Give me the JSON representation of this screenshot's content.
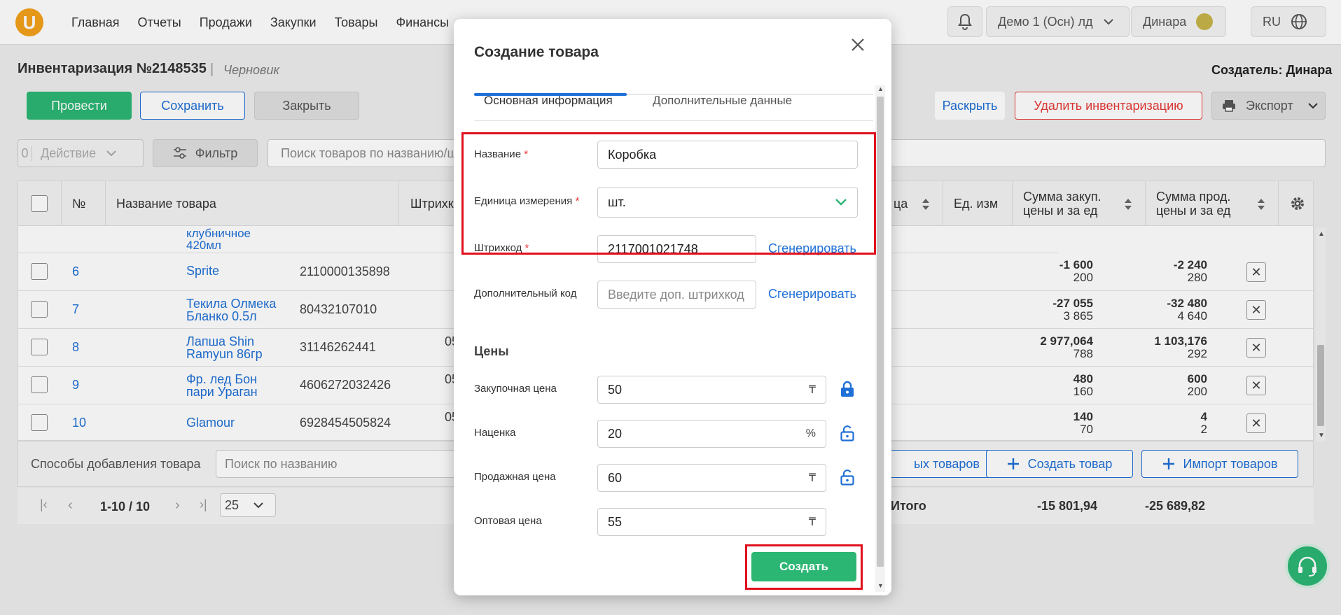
{
  "nav": {
    "logo": "U",
    "items": [
      "Главная",
      "Отчеты",
      "Продажи",
      "Закупки",
      "Товары",
      "Финансы"
    ],
    "store": "Демо 1 (Осн) лд",
    "user": "Динара",
    "lang": "RU"
  },
  "page": {
    "title": "Инвентаризация №2148535",
    "separator": "|",
    "status": "Черновик",
    "creator": "Создатель: Динара"
  },
  "toolbar": {
    "conduct": "Провести",
    "save": "Сохранить",
    "close": "Закрыть",
    "expand": "Раскрыть",
    "delete": "Удалить инвентаризацию",
    "export": "Экспорт",
    "action_count": "0",
    "action": "Действие",
    "filter": "Фильтр",
    "search_placeholder": "Поиск товаров по названию/ш"
  },
  "table": {
    "headers": {
      "num": "№",
      "name": "Название товара",
      "barcode": "Штрихк",
      "price": "ца",
      "unit": "Ед. изм",
      "sum_buy_1": "Сумма закуп.",
      "sum_buy_2": "цены и за ед",
      "sum_sell_1": "Сумма прод.",
      "sum_sell_2": "цены и за ед"
    },
    "partial_row": {
      "name_1": "клубничное",
      "name_2": "420мл"
    },
    "rows": [
      {
        "num": "6",
        "name_1": "Sprite",
        "name_2": "",
        "barcode": "2110000135898",
        "extra": "",
        "buy_total": "-1 600",
        "buy_unit": "200",
        "sell_total": "-2 240",
        "sell_unit": "280"
      },
      {
        "num": "7",
        "name_1": "Текила Олмека",
        "name_2": "Бланко 0.5л",
        "barcode": "80432107010",
        "extra": "",
        "buy_total": "-27 055",
        "buy_unit": "3 865",
        "sell_total": "-32 480",
        "sell_unit": "4 640"
      },
      {
        "num": "8",
        "name_1": "Лапша Shin",
        "name_2": "Ramyun 86гр",
        "barcode": "31146262441",
        "extra": "05",
        "buy_total": "2 977,064",
        "buy_unit": "788",
        "sell_total": "1 103,176",
        "sell_unit": "292"
      },
      {
        "num": "9",
        "name_1": "Фр. лед Бон",
        "name_2": "пари Ураган",
        "barcode": "4606272032426",
        "extra": "05",
        "buy_total": "480",
        "buy_unit": "160",
        "sell_total": "600",
        "sell_unit": "200"
      },
      {
        "num": "10",
        "name_1": "Glamour",
        "name_2": "",
        "barcode": "6928454505824",
        "extra": "05",
        "buy_total": "140",
        "buy_unit": "70",
        "sell_total": "4",
        "sell_unit": "2"
      }
    ],
    "add_methods": "Способы добавления товара",
    "add_search_placeholder": "Поиск по названию",
    "partial_btn": "ых товаров",
    "create_product": "Создать товар",
    "import_products": "Импорт товаров",
    "pagination": "1-10 / 10",
    "page_size": "25",
    "total_label": "Итого",
    "total_buy": "-15 801,94",
    "total_sell": "-25 689,82"
  },
  "modal": {
    "title": "Создание товара",
    "tabs": [
      "Основная информация",
      "Дополнительные данные"
    ],
    "name_label": "Название",
    "name_value": "Коробка",
    "unit_label": "Единица измерения",
    "unit_value": "шт.",
    "barcode_label": "Штрихкод",
    "barcode_value": "2117001021748",
    "generate": "Сгенерировать",
    "extra_code_label": "Дополнительный код",
    "extra_code_placeholder": "Введите доп. штрихкод",
    "required_mark": "*",
    "prices_heading": "Цены",
    "buy_label": "Закупочная цена",
    "buy_value": "50",
    "markup_label": "Наценка",
    "markup_value": "20",
    "sell_label": "Продажная цена",
    "sell_value": "60",
    "wholesale_label": "Оптовая цена",
    "wholesale_value": "55",
    "currency": "₸",
    "percent": "%",
    "create": "Создать"
  },
  "colors": {
    "accent_green": "#2bb673",
    "link_blue": "#1e6fd6",
    "highlight_red": "#e0101e",
    "logo_orange": "#f4a11b"
  }
}
